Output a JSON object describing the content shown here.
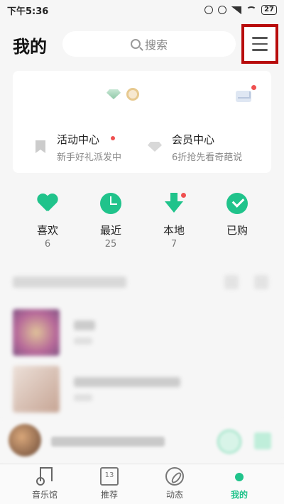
{
  "status_bar": {
    "time": "下午5:36",
    "battery": "27"
  },
  "header": {
    "title": "我的",
    "search_placeholder": "搜索"
  },
  "entries": {
    "activity": {
      "title": "活动中心",
      "subtitle": "新手好礼派发中"
    },
    "vip": {
      "title": "会员中心",
      "subtitle": "6折抢先看奇葩说"
    }
  },
  "quick": [
    {
      "label": "喜欢",
      "count": "6"
    },
    {
      "label": "最近",
      "count": "25"
    },
    {
      "label": "本地",
      "count": "7"
    },
    {
      "label": "已购",
      "count": ""
    }
  ],
  "tabs": [
    {
      "label": "音乐馆"
    },
    {
      "label": "推荐",
      "icon_text": "13"
    },
    {
      "label": "动态"
    },
    {
      "label": "我的"
    }
  ],
  "colors": {
    "accent": "#20c38b",
    "highlight_border": "#b80b0b",
    "dot": "#ef5050"
  }
}
